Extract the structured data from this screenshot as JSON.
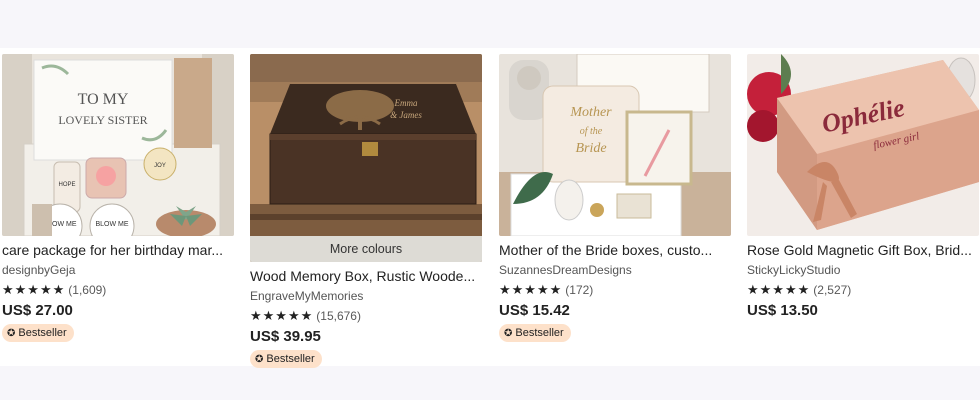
{
  "listings": [
    {
      "title": "care package for her birthday mar...",
      "shop": "designbyGeja",
      "stars": "★★★★★",
      "reviews": "(1,609)",
      "price": "US$ 27.00",
      "badge": "Bestseller",
      "image": {
        "card_text_line1": "TO MY",
        "card_text_line2": "LOVELY SISTER",
        "jar_label_1": "HOPE",
        "jar_label_2": "BLOW ME",
        "jar_label_3": "BLOW ME",
        "label_small": "JOY"
      }
    },
    {
      "title": "Wood Memory Box, Rustic Woode...",
      "shop": "EngraveMyMemories",
      "stars": "★★★★★",
      "reviews": "(15,676)",
      "price": "US$ 39.95",
      "badge": "Bestseller",
      "overlay": "More colours",
      "image": {
        "engraving_line1": "Emma",
        "engraving_line2": "& James"
      }
    },
    {
      "title": "Mother of the Bride boxes, custo...",
      "shop": "SuzannesDreamDesigns",
      "stars": "★★★★★",
      "reviews": "(172)",
      "price": "US$ 15.42",
      "badge": "Bestseller",
      "image": {
        "pillow_line1": "Mother",
        "pillow_line2": "of the",
        "pillow_line3": "Bride"
      }
    },
    {
      "title": "Rose Gold Magnetic Gift Box, Brid...",
      "shop": "StickyLickyStudio",
      "stars": "★★★★★",
      "reviews": "(2,527)",
      "price": "US$ 13.50",
      "image": {
        "box_name": "Ophélie",
        "box_subtitle": "flower girl"
      }
    }
  ],
  "colors": {
    "badge_bg": "#fde1ca",
    "rose_gold": "#e7b6a0",
    "wood_dark": "#4a3325"
  }
}
